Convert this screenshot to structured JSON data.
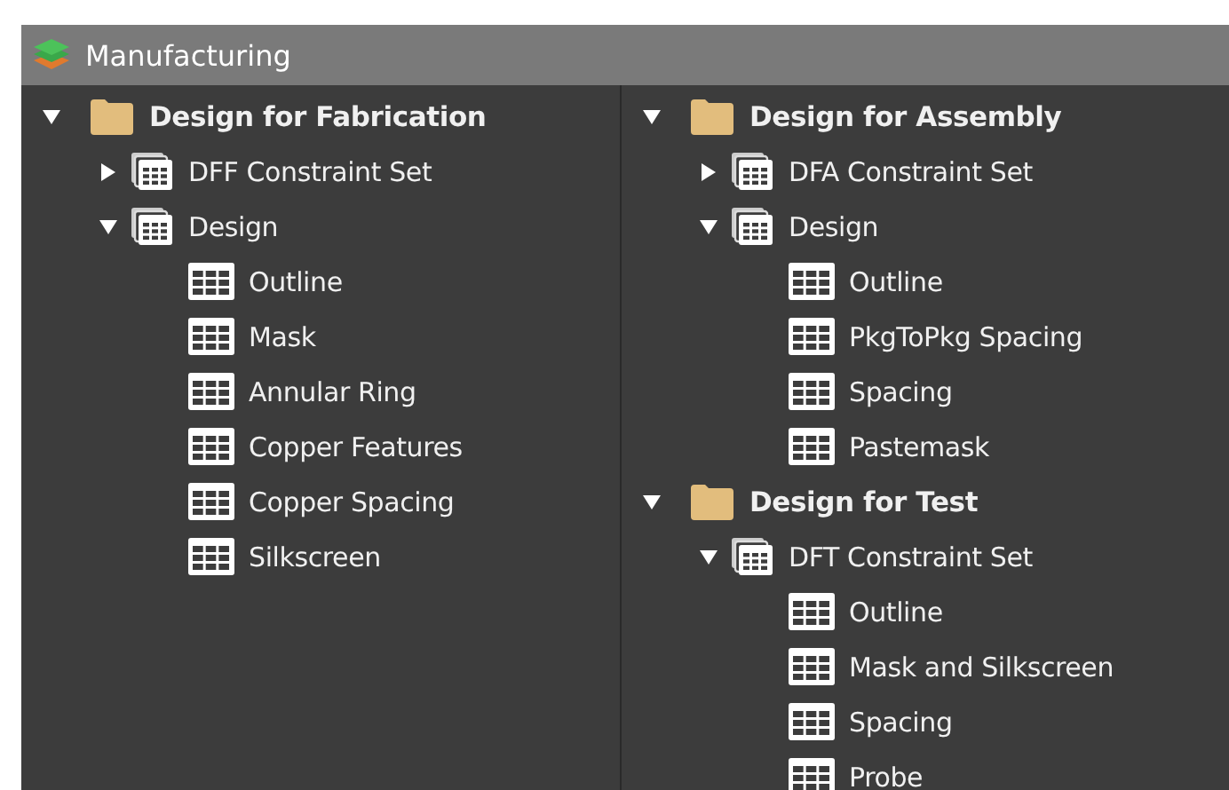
{
  "window": {
    "title": "Manufacturing"
  },
  "panels": [
    {
      "roots": [
        {
          "label": "Design for Fabrication",
          "kind": "folder",
          "expanded": true,
          "children": [
            {
              "label": "DFF Constraint Set",
              "kind": "set",
              "expanded": false
            },
            {
              "label": "Design",
              "kind": "set",
              "expanded": true,
              "children": [
                {
                  "label": "Outline",
                  "kind": "table"
                },
                {
                  "label": "Mask",
                  "kind": "table"
                },
                {
                  "label": "Annular Ring",
                  "kind": "table"
                },
                {
                  "label": "Copper Features",
                  "kind": "table"
                },
                {
                  "label": "Copper Spacing",
                  "kind": "table"
                },
                {
                  "label": "Silkscreen",
                  "kind": "table"
                }
              ]
            }
          ]
        }
      ]
    },
    {
      "roots": [
        {
          "label": "Design for Assembly",
          "kind": "folder",
          "expanded": true,
          "children": [
            {
              "label": "DFA Constraint Set",
              "kind": "set",
              "expanded": false
            },
            {
              "label": "Design",
              "kind": "set",
              "expanded": true,
              "children": [
                {
                  "label": "Outline",
                  "kind": "table"
                },
                {
                  "label": "PkgToPkg Spacing",
                  "kind": "table"
                },
                {
                  "label": "Spacing",
                  "kind": "table"
                },
                {
                  "label": "Pastemask",
                  "kind": "table"
                }
              ]
            }
          ]
        },
        {
          "label": "Design for Test",
          "kind": "folder",
          "expanded": true,
          "children": [
            {
              "label": "DFT Constraint Set",
              "kind": "set",
              "expanded": true,
              "children": [
                {
                  "label": "Outline",
                  "kind": "table"
                },
                {
                  "label": "Mask and Silkscreen",
                  "kind": "table"
                },
                {
                  "label": "Spacing",
                  "kind": "table"
                },
                {
                  "label": "Probe",
                  "kind": "table"
                }
              ]
            }
          ]
        }
      ]
    }
  ]
}
